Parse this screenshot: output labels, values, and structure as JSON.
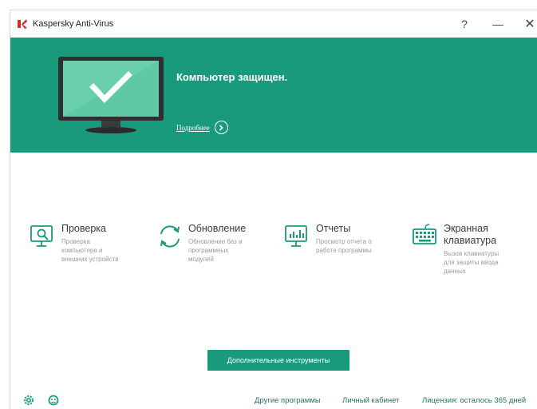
{
  "window": {
    "title": "Kaspersky Anti-Virus",
    "help_glyph": "?",
    "minimize_glyph": "—",
    "close_glyph": "✕"
  },
  "status": {
    "title": "Компьютер защищен.",
    "details_link": "Подробнее"
  },
  "tiles": [
    {
      "title": "Проверка",
      "title2": "",
      "desc": [
        "Проверка",
        "компьютера и",
        "внешних устройств"
      ],
      "icon": "scan-monitor-icon"
    },
    {
      "title": "Обновление",
      "title2": "",
      "desc": [
        "Обновление баз и",
        "программных",
        "модулей"
      ],
      "icon": "update-arrows-icon"
    },
    {
      "title": "Отчеты",
      "title2": "",
      "desc": [
        "Просмотр отчета о",
        "работе программы"
      ],
      "icon": "report-chart-icon"
    },
    {
      "title": "Экранная",
      "title2": "клавиатура",
      "desc": [
        "Вызов клавиатуры",
        "для защиты ввода",
        "данных"
      ],
      "icon": "keyboard-icon"
    }
  ],
  "tools_button": "Дополнительные инструменты",
  "footer": {
    "other_programs": "Другие программы",
    "cabinet": "Личный кабинет",
    "license": "Лицензия: осталось 365 дней"
  },
  "colors": {
    "accent": "#1a9a7c",
    "brand_red": "#d12b2b",
    "link": "#1a7a64"
  }
}
